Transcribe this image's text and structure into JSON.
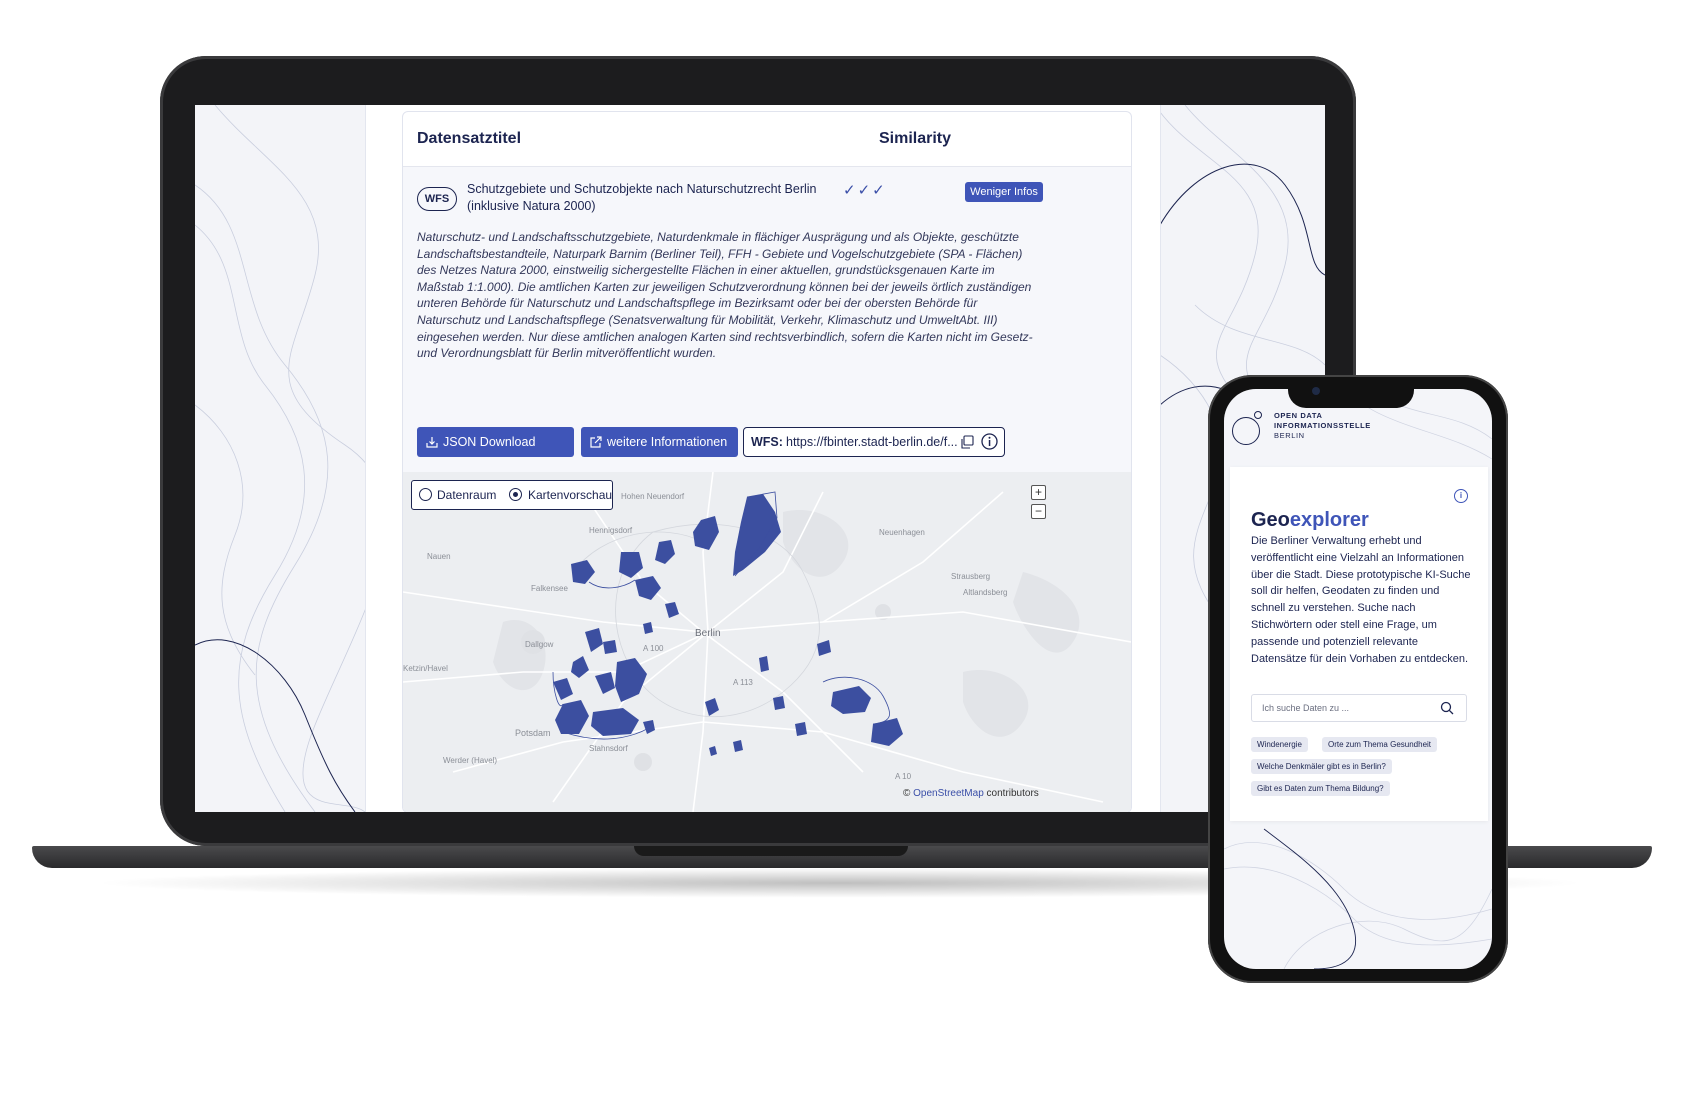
{
  "laptop": {
    "table": {
      "header_title": "Datensatztitel",
      "header_similarity": "Similarity"
    },
    "dataset": {
      "type_badge": "WFS",
      "title": "Schutzgebiete und Schutzobjekte nach Naturschutzrecht Berlin (inklusive Natura 2000)",
      "similarity_checks": "✓✓✓",
      "less_info_button": "Weniger Infos",
      "description": "Naturschutz- und Landschaftsschutzgebiete, Naturdenkmale in flächiger Ausprägung und als Objekte, geschützte Landschaftsbestandteile, Naturpark Barnim (Berliner Teil), FFH - Gebiete und Vogelschutzgebiete (SPA - Flächen) des Netzes Natura 2000, einstweilig sichergestellte Flächen in einer aktuellen, grundstücksgenauen Karte im Maßstab 1:1.000). Die amtlichen Karten zur jeweiligen Schutzverordnung können bei der jeweils örtlich zuständigen unteren Behörde für Naturschutz und Landschaftspflege im Bezirksamt oder bei der obersten Behörde für Naturschutz und Landschaftspflege (Senatsverwaltung für Mobilität, Verkehr, Klimaschutz und UmweltAbt. III) eingesehen werden. Nur diese amtlichen analogen Karten sind rechtsverbindlich, sofern die Karten nicht im Gesetz- und Verordnungsblatt für Berlin mitveröffentlicht wurden.",
      "json_download_label": "JSON Download",
      "more_info_label": "weitere Informationen",
      "wfs_label": "WFS:",
      "wfs_url": "https://fbinter.stadt-berlin.de/f..."
    },
    "map": {
      "toggle_option_1": "Datenraum",
      "toggle_option_2": "Kartenvorschau",
      "selected_option": "Kartenvorschau",
      "zoom_in": "+",
      "zoom_out": "−",
      "attribution_prefix": "©",
      "attribution_link": "OpenStreetMap",
      "attribution_suffix": "contributors",
      "labels": {
        "hohen_neuendorf": "Hohen Neuendorf",
        "hennigsdorf": "Hennigsdorf",
        "nauen": "Nauen",
        "falkensee": "Falkensee",
        "dallgow": "Dallgow",
        "berlin": "Berlin",
        "potsdam": "Potsdam",
        "stahnsdorf": "Stahnsdorf",
        "werder": "Werder (Havel)",
        "ketzin": "Ketzin/Havel",
        "neuenhagen": "Neuenhagen",
        "altlandsberg": "Altlandsberg",
        "strausberg": "Strausberg",
        "a100": "A 100",
        "a113": "A 113",
        "a10": "A 10"
      }
    },
    "colors": {
      "navy": "#1c2450",
      "accent": "#3f55b8",
      "protected_area": "#3c4fa0"
    }
  },
  "phone": {
    "logo_line1": "OPEN DATA",
    "logo_line2": "INFORMATIONSSTELLE",
    "logo_line3": "BERLIN",
    "title_prefix": "Geo",
    "title_accent": "explorer",
    "intro": "Die Berliner Verwaltung erhebt und veröffentlicht eine Vielzahl an Informationen über die Stadt. Diese prototypische KI-Suche soll dir helfen, Geodaten zu finden und schnell zu verstehen. Suche nach Stichwörtern oder stell eine Frage, um passende und potenziell relevante Datensätze für dein Vorhaben zu entdecken.",
    "search_placeholder": "Ich suche Daten zu ...",
    "suggestions": [
      "Windenergie",
      "Orte zum Thema Gesundheit",
      "Welche Denkmäler gibt es in Berlin?",
      "Gibt es Daten zum Thema Bildung?"
    ]
  }
}
